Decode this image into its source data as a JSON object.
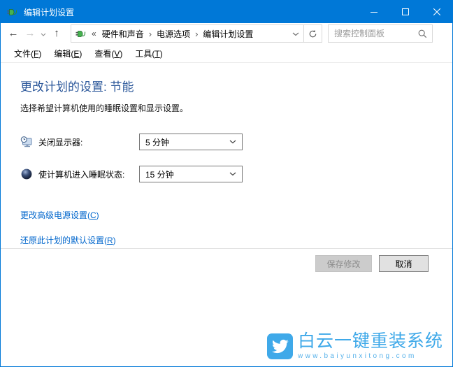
{
  "window": {
    "title": "编辑计划设置",
    "accent_color": "#0078d7",
    "controls": {
      "minimize": "minimize",
      "maximize": "maximize",
      "close": "close"
    }
  },
  "toolbar": {
    "nav": {
      "back": "←",
      "forward": "→",
      "up": "↑"
    },
    "breadcrumb": {
      "collapse": "«",
      "separator": "›",
      "segments": [
        "硬件和声音",
        "电源选项",
        "编辑计划设置"
      ]
    },
    "search": {
      "placeholder": "搜索控制面板"
    }
  },
  "menubar": {
    "items": [
      {
        "prefix": "文件(",
        "key": "F",
        "suffix": ")"
      },
      {
        "prefix": "编辑(",
        "key": "E",
        "suffix": ")"
      },
      {
        "prefix": "查看(",
        "key": "V",
        "suffix": ")"
      },
      {
        "prefix": "工具(",
        "key": "T",
        "suffix": ")"
      }
    ]
  },
  "main": {
    "heading": "更改计划的设置: 节能",
    "heading_color": "#2b579a",
    "subtitle": "选择希望计算机使用的睡眠设置和显示设置。",
    "settings": [
      {
        "icon": "display-off-timer-icon",
        "label": "关闭显示器:",
        "value": "5 分钟"
      },
      {
        "icon": "sleep-orb-icon",
        "label": "使计算机进入睡眠状态:",
        "value": "15 分钟"
      }
    ],
    "links": [
      {
        "prefix": "更改高级电源设置(",
        "key": "C",
        "suffix": ")"
      },
      {
        "prefix": "还原此计划的默认设置(",
        "key": "R",
        "suffix": ")"
      }
    ],
    "buttons": {
      "save": {
        "label": "保存修改",
        "enabled": false
      },
      "cancel": {
        "label": "取消",
        "enabled": true
      }
    },
    "link_color": "#0066cc"
  },
  "watermark": {
    "title": "白云一键重装系统",
    "url": "www.baiyunxitong.com",
    "color": "#3fa9e9"
  }
}
